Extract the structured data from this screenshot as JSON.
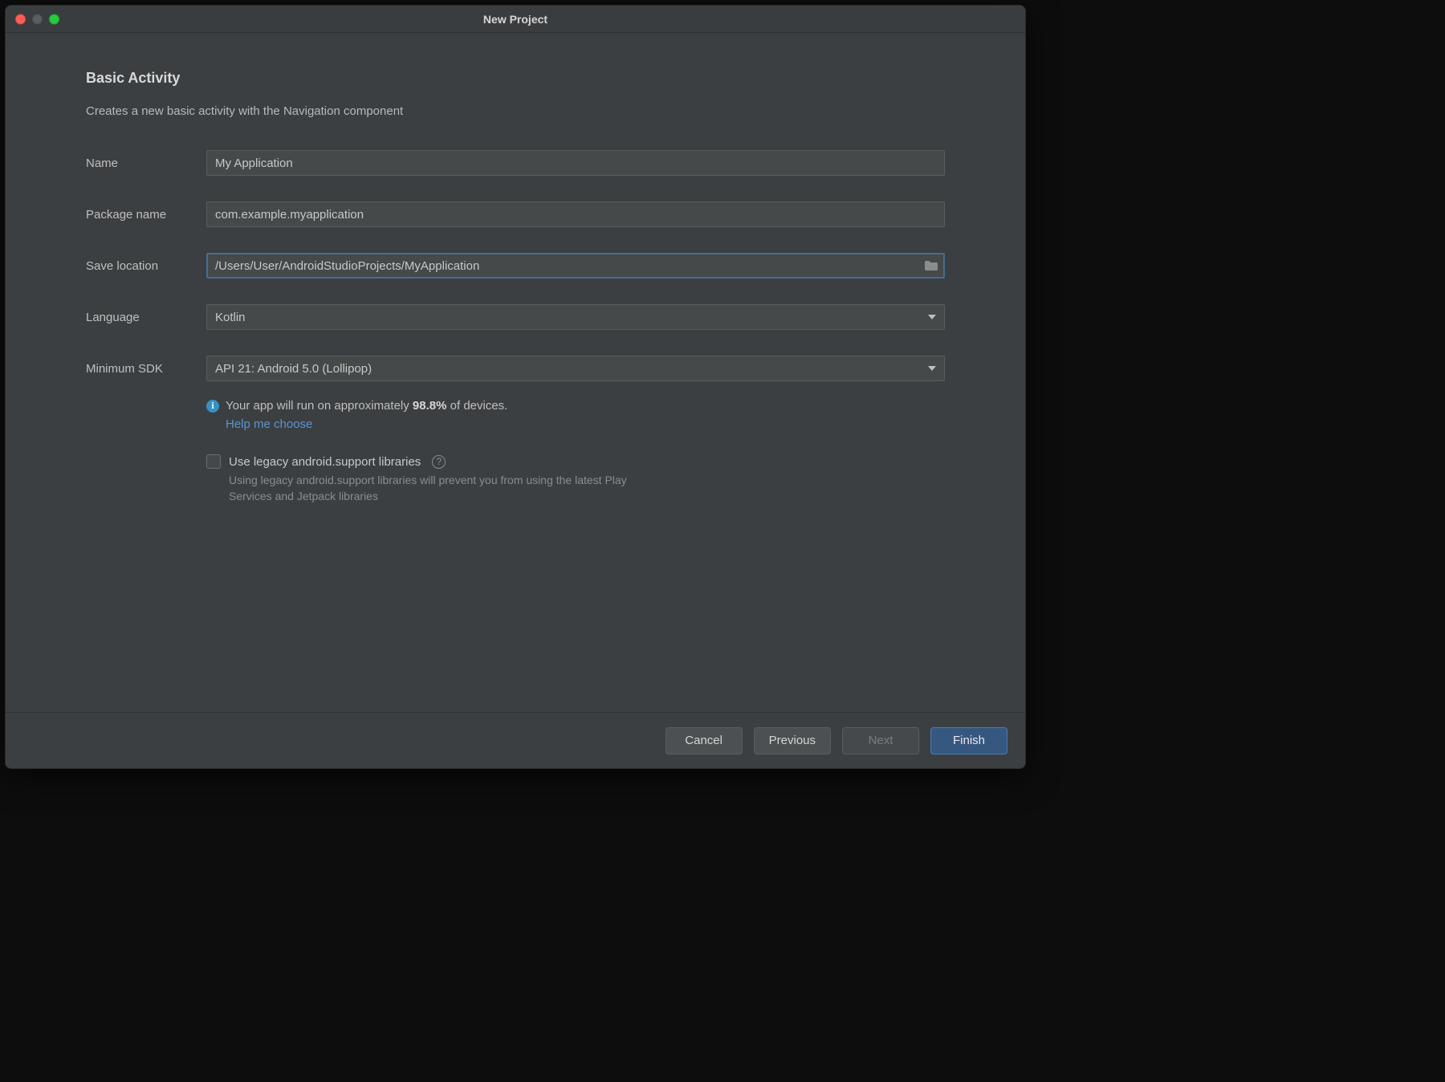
{
  "window": {
    "title": "New Project"
  },
  "page": {
    "heading": "Basic Activity",
    "subheading": "Creates a new basic activity with the Navigation component"
  },
  "form": {
    "name": {
      "label": "Name",
      "value": "My Application"
    },
    "package": {
      "label": "Package name",
      "value": "com.example.myapplication"
    },
    "location": {
      "label": "Save location",
      "value": "/Users/User/AndroidStudioProjects/MyApplication"
    },
    "language": {
      "label": "Language",
      "value": "Kotlin"
    },
    "minsdk": {
      "label": "Minimum SDK",
      "value": "API 21: Android 5.0 (Lollipop)"
    }
  },
  "info": {
    "prefix": "Your app will run on approximately ",
    "percent": "98.8%",
    "suffix": " of devices.",
    "help_link": "Help me choose"
  },
  "legacy": {
    "label": "Use legacy android.support libraries",
    "desc": "Using legacy android.support libraries will prevent you from using the latest Play Services and Jetpack libraries"
  },
  "footer": {
    "cancel": "Cancel",
    "previous": "Previous",
    "next": "Next",
    "finish": "Finish"
  }
}
